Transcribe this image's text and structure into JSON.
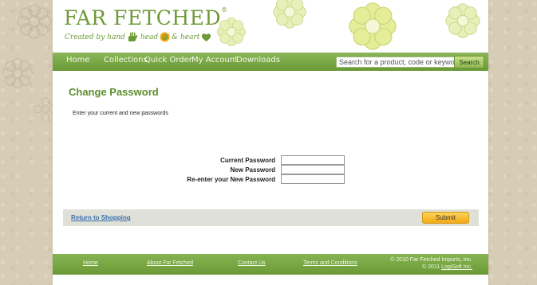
{
  "brand": {
    "name": "FAR FETCHED",
    "trademark": "®",
    "tagline_prefix": "Created by hand",
    "tagline_head": "head",
    "tagline_heart": "& heart"
  },
  "nav": {
    "items": [
      {
        "label": "Home"
      },
      {
        "label": "Collections"
      },
      {
        "label": "Quick Order"
      },
      {
        "label": "My Account"
      },
      {
        "label": "Downloads"
      }
    ],
    "search_placeholder": "Search for a product, code or keyword",
    "search_button": "Search"
  },
  "main": {
    "title": "Change Password",
    "instructions": "Enter your current and new passwords",
    "fields": [
      {
        "label": "Current Password",
        "value": ""
      },
      {
        "label": "New Password",
        "value": ""
      },
      {
        "label": "Re-enter your New Password",
        "value": ""
      }
    ]
  },
  "actions": {
    "return_label": "Return to Shopping",
    "submit_label": "Submit"
  },
  "footer": {
    "links": [
      {
        "label": "Home"
      },
      {
        "label": "About Far Fetched"
      },
      {
        "label": "Contact Us"
      },
      {
        "label": "Terms and Conditions"
      }
    ],
    "copyright_line1": "© 2010 Far Fetched Imports, Inc.",
    "copyright_line2": "© 2011",
    "copyright_link": "LogiSoft Inc."
  },
  "colors": {
    "brand_green": "#6c9a34",
    "nav_green": "#7aa845",
    "submit_yellow": "#f5b82a",
    "link_blue": "#3a6ea8",
    "background": "#d7cdb6"
  },
  "icons": [
    "hand-icon",
    "swirl-icon",
    "heart-icon",
    "flower-icon"
  ]
}
